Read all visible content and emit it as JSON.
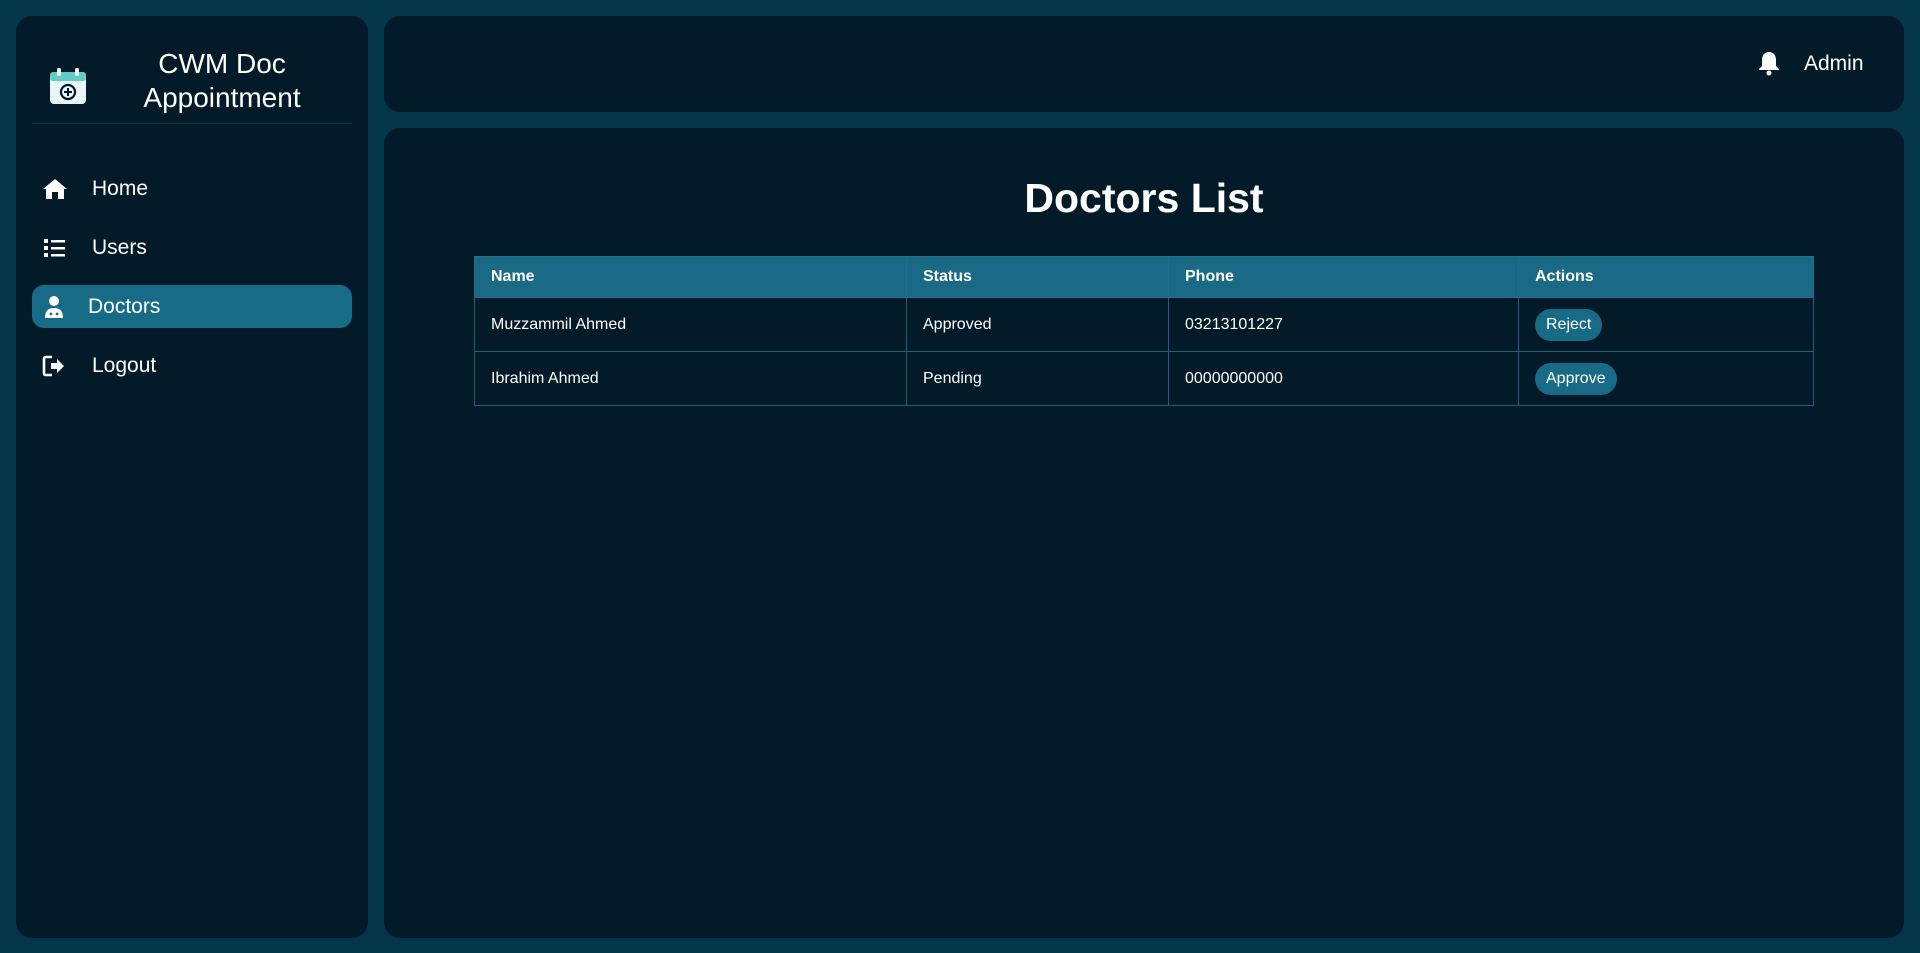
{
  "sidebar": {
    "brand": {
      "line1": "CWM Doc",
      "line2": "Appointment",
      "icon": "calendar-plus-icon"
    },
    "items": [
      {
        "label": "Home",
        "icon": "home-icon",
        "active": false
      },
      {
        "label": "Users",
        "icon": "list-icon",
        "active": false
      },
      {
        "label": "Doctors",
        "icon": "doctor-icon",
        "active": true
      },
      {
        "label": "Logout",
        "icon": "logout-icon",
        "active": false
      }
    ]
  },
  "header": {
    "user": "Admin",
    "icon": "bell-icon"
  },
  "main": {
    "title": "Doctors List",
    "table": {
      "headers": [
        "Name",
        "Status",
        "Phone",
        "Actions"
      ],
      "rows": [
        {
          "name": "Muzzammil Ahmed",
          "status": "Approved",
          "phone": "03213101227",
          "action": "Reject"
        },
        {
          "name": "Ibrahim Ahmed",
          "status": "Pending",
          "phone": "00000000000",
          "action": "Approve"
        }
      ]
    }
  },
  "colors": {
    "background": "#04364a",
    "panel": "#031b28",
    "accent": "#176b87",
    "text": "#ffffff"
  }
}
